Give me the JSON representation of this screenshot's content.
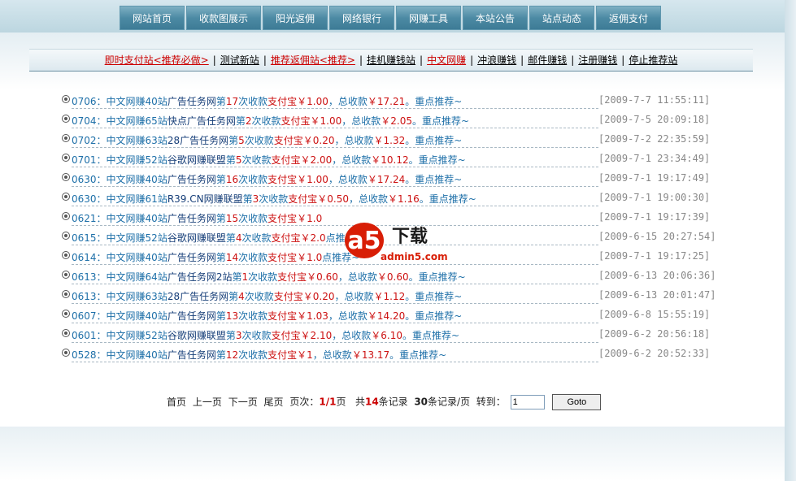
{
  "nav": [
    "网站首页",
    "收款图展示",
    "阳光返佣",
    "网络银行",
    "网赚工具",
    "本站公告",
    "站点动态",
    "返佣支付"
  ],
  "links": [
    {
      "text": "即时支付站<推荐必做>",
      "red": true
    },
    {
      "text": "测试新站",
      "red": false
    },
    {
      "text": "推荐返佣站<推荐>",
      "red": true
    },
    {
      "text": "挂机赚钱站",
      "red": false
    },
    {
      "text": "中文网赚",
      "red": true
    },
    {
      "text": "冲浪赚钱",
      "red": false
    },
    {
      "text": "邮件赚钱",
      "red": false
    },
    {
      "text": "注册赚钱",
      "red": false
    },
    {
      "text": "停止推荐站",
      "red": false
    }
  ],
  "rows": [
    {
      "code": "0706：",
      "site": "中文网赚40站",
      "name": "广告任务网",
      "pre": "第",
      "num": "17",
      "post": "次收款",
      "pay": "支付宝￥1.00",
      "sep": "，总收款",
      "total": "￥17.21",
      "end": "。重点推荐~",
      "date": "[2009-7-7 11:55:11]"
    },
    {
      "code": "0704：",
      "site": "中文网赚65站",
      "name": "快点广告任务网",
      "pre": "第",
      "num": "2",
      "post": "次收款",
      "pay": "支付宝￥1.00",
      "sep": "，总收款",
      "total": "￥2.05",
      "end": "。重点推荐~",
      "date": "[2009-7-5 20:09:18]"
    },
    {
      "code": "0702：",
      "site": "中文网赚63站",
      "name": "28广告任务网",
      "pre": "第",
      "num": "5",
      "post": "次收款",
      "pay": "支付宝￥0.20",
      "sep": "，总收款",
      "total": "￥1.32",
      "end": "。重点推荐~",
      "date": "[2009-7-2 22:35:59]"
    },
    {
      "code": "0701：",
      "site": "中文网赚52站",
      "name": "谷歌网赚联盟",
      "pre": "第",
      "num": "5",
      "post": "次收款",
      "pay": "支付宝￥2.00",
      "sep": "，总收款",
      "total": "￥10.12",
      "end": "。重点推荐~",
      "date": "[2009-7-1 23:34:49]"
    },
    {
      "code": "0630：",
      "site": "中文网赚40站",
      "name": "广告任务网",
      "pre": "第",
      "num": "16",
      "post": "次收款",
      "pay": "支付宝￥1.00",
      "sep": "，总收款",
      "total": "￥17.24",
      "end": "。重点推荐~",
      "date": "[2009-7-1 19:17:49]"
    },
    {
      "code": "0630：",
      "site": "中文网赚61站",
      "name": "R39.CN网赚联盟",
      "pre": "第",
      "num": "3",
      "post": "次收款",
      "pay": "支付宝￥0.50",
      "sep": "，总收款",
      "total": "￥1.16",
      "end": "。重点推荐~",
      "date": "[2009-7-1 19:00:30]"
    },
    {
      "code": "0621：",
      "site": "中文网赚40站",
      "name": "广告任务网",
      "pre": "第",
      "num": "15",
      "post": "次收款",
      "pay": "支付宝￥1.0",
      "sep": "",
      "total": "",
      "end": "",
      "date": "[2009-7-1 19:17:39]"
    },
    {
      "code": "0615：",
      "site": "中文网赚52站",
      "name": "谷歌网赚联盟",
      "pre": "第",
      "num": "4",
      "post": "次收款",
      "pay": "支付宝￥2.0",
      "sep": "",
      "total": "",
      "end": "点推荐~",
      "date": "[2009-6-15 20:27:54]"
    },
    {
      "code": "0614：",
      "site": "中文网赚40站",
      "name": "广告任务网",
      "pre": "第",
      "num": "14",
      "post": "次收款",
      "pay": "支付宝￥1.0",
      "sep": "",
      "total": "",
      "end": "点推荐~",
      "date": "[2009-7-1 19:17:25]"
    },
    {
      "code": "0613：",
      "site": "中文网赚64站",
      "name": "广告任务网2站",
      "pre": "第",
      "num": "1",
      "post": "次收款",
      "pay": "支付宝￥0.60",
      "sep": "，总收款",
      "total": "￥0.60",
      "end": "。重点推荐~",
      "date": "[2009-6-13 20:06:36]"
    },
    {
      "code": "0613：",
      "site": "中文网赚63站",
      "name": "28广告任务网",
      "pre": "第",
      "num": "4",
      "post": "次收款",
      "pay": "支付宝￥0.20",
      "sep": "，总收款",
      "total": "￥1.12",
      "end": "。重点推荐~",
      "date": "[2009-6-13 20:01:47]"
    },
    {
      "code": "0607：",
      "site": "中文网赚40站",
      "name": "广告任务网",
      "pre": "第",
      "num": "13",
      "post": "次收款",
      "pay": "支付宝￥1.03",
      "sep": "，总收款",
      "total": "￥14.20",
      "end": "。重点推荐~",
      "date": "[2009-6-8 15:55:19]"
    },
    {
      "code": "0601：",
      "site": "中文网赚52站",
      "name": "谷歌网赚联盟",
      "pre": "第",
      "num": "3",
      "post": "次收款",
      "pay": "支付宝￥2.10",
      "sep": "，总收款",
      "total": "￥6.10",
      "end": "。重点推荐~",
      "date": "[2009-6-2 20:56:18]"
    },
    {
      "code": "0528：",
      "site": "中文网赚40站",
      "name": "广告任务网",
      "pre": "第",
      "num": "12",
      "post": "次收款",
      "pay": "支付宝￥1",
      "sep": "，总收款",
      "total": "￥13.17",
      "end": "。重点推荐~",
      "date": "[2009-6-2 20:52:33]"
    }
  ],
  "pager": {
    "first": "首页",
    "prev": "上一页",
    "next": "下一页",
    "last": "尾页",
    "page_label": "页次：",
    "page_cur": "1/1",
    "page_unit": "页",
    "total_pre": "共",
    "total_num": "14",
    "total_post": "条记录",
    "per_num": "30",
    "per_post": "条记录/页",
    "goto_label": "转到：",
    "goto_value": "1",
    "goto_button": "Goto"
  },
  "watermark": {
    "logo": "a5",
    "text": "下载",
    "site": "admin5.com"
  },
  "colors": {
    "nav_bg": "#4c8aa4",
    "link_red": "#cc0000",
    "title_blue": "#1d6fa8"
  }
}
